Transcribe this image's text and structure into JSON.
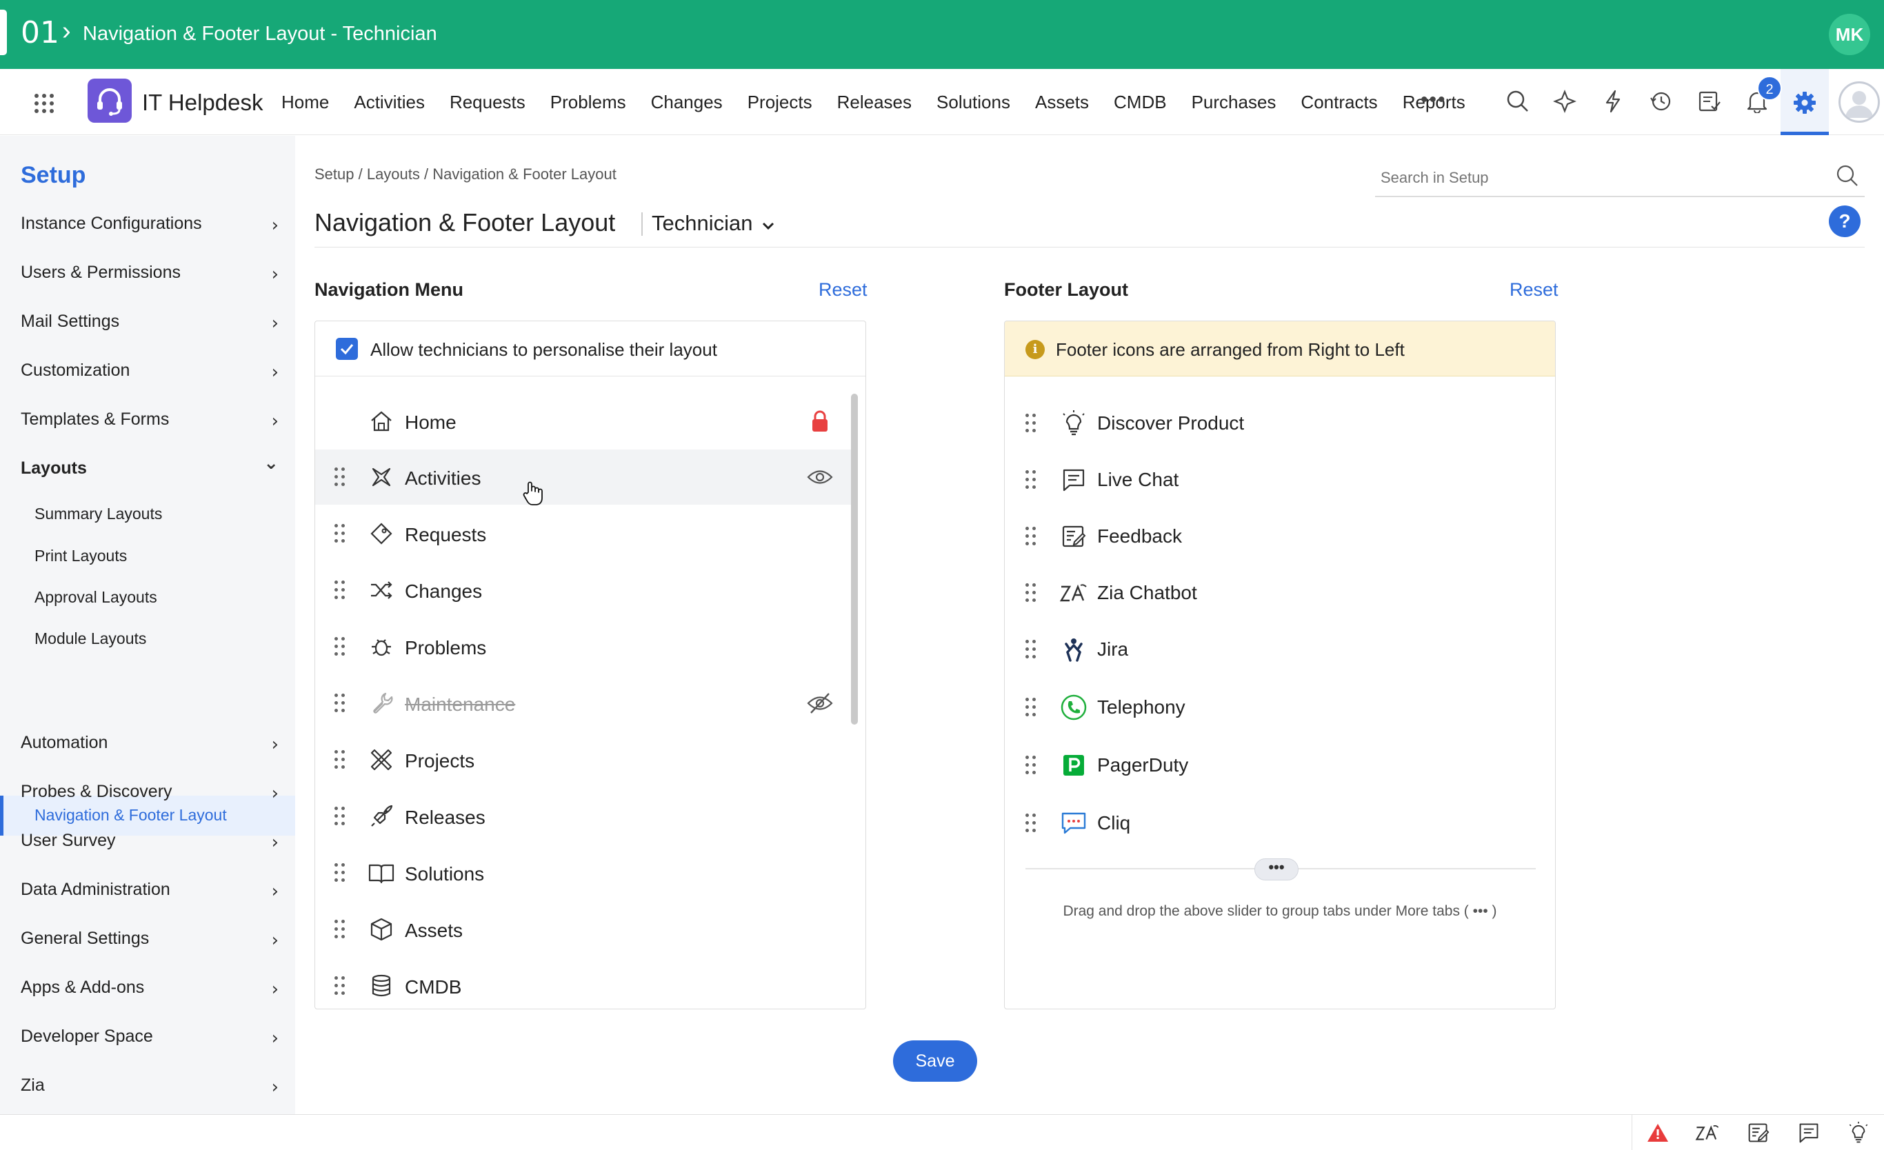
{
  "banner": {
    "number": "01",
    "title": "Navigation & Footer Layout - Technician",
    "user_initials": "MK"
  },
  "app": {
    "name": "IT Helpdesk"
  },
  "top_nav": {
    "items": [
      "Home",
      "Activities",
      "Requests",
      "Problems",
      "Changes",
      "Projects",
      "Releases",
      "Solutions",
      "Assets",
      "CMDB",
      "Purchases",
      "Contracts",
      "Reports"
    ],
    "more_label": "•••",
    "notification_count": "2",
    "icons": [
      "search-icon",
      "magic-icon",
      "lightning-icon",
      "history-icon",
      "checklist-icon",
      "bell-icon",
      "gear-icon",
      "avatar"
    ]
  },
  "sidebar": {
    "title": "Setup",
    "items": [
      {
        "label": "Instance Configurations",
        "chevron": "›"
      },
      {
        "label": "Users & Permissions",
        "chevron": "›"
      },
      {
        "label": "Mail Settings",
        "chevron": "›"
      },
      {
        "label": "Customization",
        "chevron": "›"
      },
      {
        "label": "Templates & Forms",
        "chevron": "›"
      },
      {
        "label": "Layouts",
        "chevron": "⌄"
      },
      {
        "label": "Automation",
        "chevron": "›"
      },
      {
        "label": "Probes & Discovery",
        "chevron": "›"
      },
      {
        "label": "User Survey",
        "chevron": "›"
      },
      {
        "label": "Data Administration",
        "chevron": "›"
      },
      {
        "label": "General Settings",
        "chevron": "›"
      },
      {
        "label": "Apps & Add-ons",
        "chevron": "›"
      },
      {
        "label": "Developer Space",
        "chevron": "›"
      },
      {
        "label": "Zia",
        "chevron": "›"
      }
    ],
    "layouts_sub": [
      "Summary Layouts",
      "Print Layouts",
      "Approval Layouts",
      "Module Layouts",
      "Navigation & Footer Layout"
    ]
  },
  "breadcrumb": "Setup / Layouts / Navigation & Footer Layout",
  "search": {
    "placeholder": "Search in Setup"
  },
  "page": {
    "title": "Navigation & Footer Layout",
    "role": "Technician",
    "help": "?"
  },
  "navigation_menu": {
    "title": "Navigation Menu",
    "reset": "Reset",
    "allow_text": "Allow technicians to personalise their layout",
    "allow_checked": true,
    "items": [
      {
        "label": "Home",
        "icon": "home-icon",
        "state": "locked"
      },
      {
        "label": "Activities",
        "icon": "activities-icon",
        "state": "visible"
      },
      {
        "label": "Requests",
        "icon": "requests-icon",
        "state": ""
      },
      {
        "label": "Changes",
        "icon": "changes-icon",
        "state": ""
      },
      {
        "label": "Problems",
        "icon": "problems-icon",
        "state": ""
      },
      {
        "label": "Maintenance",
        "icon": "maintenance-icon",
        "state": "hidden"
      },
      {
        "label": "Projects",
        "icon": "projects-icon",
        "state": ""
      },
      {
        "label": "Releases",
        "icon": "releases-icon",
        "state": ""
      },
      {
        "label": "Solutions",
        "icon": "solutions-icon",
        "state": ""
      },
      {
        "label": "Assets",
        "icon": "assets-icon",
        "state": ""
      },
      {
        "label": "CMDB",
        "icon": "cmdb-icon",
        "state": ""
      }
    ]
  },
  "footer_layout": {
    "title": "Footer Layout",
    "reset": "Reset",
    "info": "Footer icons are arranged from Right to Left",
    "items": [
      {
        "label": "Discover Product",
        "icon": "bulb-icon"
      },
      {
        "label": "Live Chat",
        "icon": "chat-icon"
      },
      {
        "label": "Feedback",
        "icon": "feedback-icon"
      },
      {
        "label": "Zia Chatbot",
        "icon": "zia-icon"
      },
      {
        "label": "Jira",
        "icon": "jira-icon"
      },
      {
        "label": "Telephony",
        "icon": "telephony-icon"
      },
      {
        "label": "PagerDuty",
        "icon": "pagerduty-icon"
      },
      {
        "label": "Cliq",
        "icon": "cliq-icon"
      }
    ],
    "slider_label": "•••",
    "drag_note": "Drag and drop the above slider to group tabs under More tabs (  •••  )"
  },
  "save_label": "Save",
  "bottom_bar": {
    "icons": [
      "warning-icon",
      "zia-icon",
      "feedback-icon",
      "chat-icon",
      "bulb-icon"
    ]
  },
  "colors": {
    "banner": "#16a877",
    "accent": "#2e6cdb",
    "lock": "#e84040",
    "info_bg": "#fdf3d6"
  }
}
